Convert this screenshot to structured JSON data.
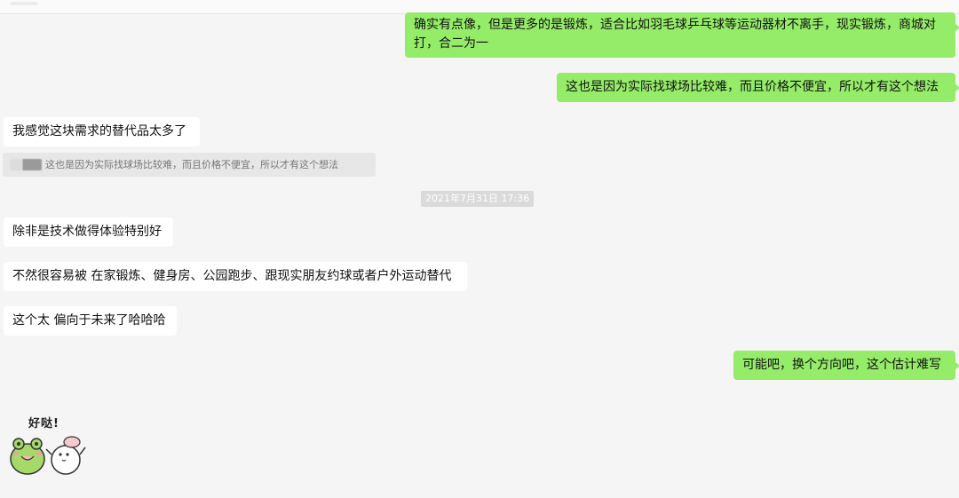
{
  "messages": [
    {
      "side": "out",
      "text": "确实有点像，但是更多的是锻炼，适合比如羽毛球乒乓球等运动器材不离手，现实锻炼，商城对打，合二为一"
    },
    {
      "side": "out",
      "text": "这也是因为实际找球场比较难，而且价格不便宜，所以才有这个想法"
    },
    {
      "side": "in",
      "text": "我感觉这块需求的替代品太多了"
    },
    {
      "side": "in",
      "text": "除非是技术做得体验特别好"
    },
    {
      "side": "in",
      "text": "不然很容易被 在家锻炼、健身房、公园跑步、跟现实朋友约球或者户外运动替代"
    },
    {
      "side": "in",
      "text": "这个太 偏向于未来了哈哈哈"
    },
    {
      "side": "out",
      "text": "可能吧，换个方向吧，这个估计难写"
    }
  ],
  "quote": {
    "text": "这也是因为实际找球场比较难，而且价格不便宜，所以才有这个想法"
  },
  "timestamp": "2021年7月31日 17:36",
  "sticker": {
    "caption": "好哒!",
    "icon": "frog-and-bunny-sticker"
  },
  "colors": {
    "outgoing": "#95ec69",
    "incoming": "#ffffff",
    "background": "#f5f5f5"
  }
}
